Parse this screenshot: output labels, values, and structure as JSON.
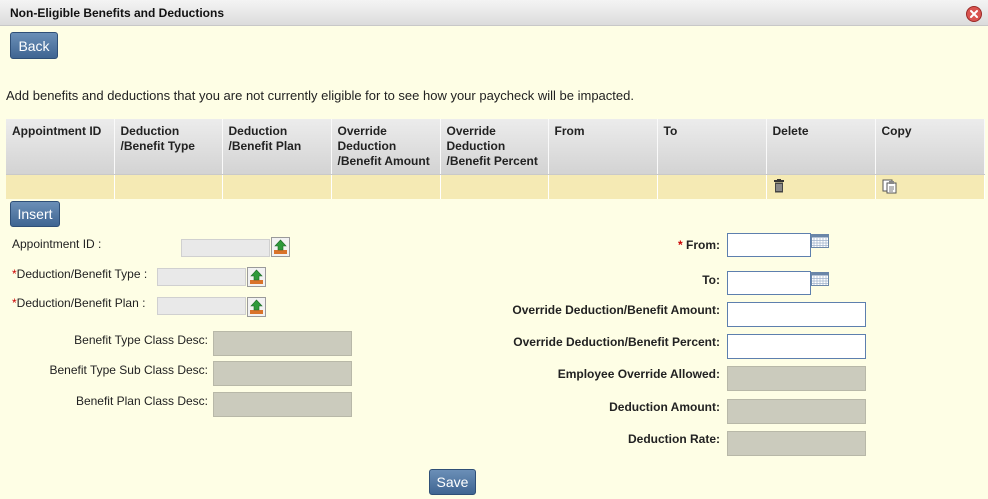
{
  "window": {
    "title": "Non-Eligible Benefits and Deductions"
  },
  "buttons": {
    "back": "Back",
    "insert": "Insert",
    "save": "Save"
  },
  "intro": "Add benefits and deductions that you are not currently eligible for to see how your paycheck will be impacted.",
  "table": {
    "headers": {
      "appointment_id": "Appointment ID",
      "type_line1": "Deduction",
      "type_line2": "/Benefit Type",
      "plan_line1": "Deduction",
      "plan_line2": "/Benefit Plan",
      "amount_line1": "Override",
      "amount_line2": "Deduction",
      "amount_line3": "/Benefit Amount",
      "percent_line1": "Override",
      "percent_line2": "Deduction",
      "percent_line3": "/Benefit Percent",
      "from": "From",
      "to": "To",
      "delete": "Delete",
      "copy": "Copy"
    },
    "rows": [
      {
        "appointment_id": "",
        "type": "",
        "plan": "",
        "amount": "",
        "percent": "",
        "from": "",
        "to": ""
      }
    ]
  },
  "form": {
    "appointment_id_label": "Appointment ID :",
    "required_mark": "*",
    "type_label": "Deduction/Benefit Type :",
    "plan_label": "Deduction/Benefit Plan :",
    "type_class_label": "Benefit Type Class Desc:",
    "type_subclass_label": "Benefit Type Sub Class Desc:",
    "plan_class_label": "Benefit Plan Class Desc:",
    "from_label": "From:",
    "to_label": "To:",
    "override_amount_label": "Override Deduction/Benefit Amount:",
    "override_percent_label": "Override Deduction/Benefit Percent:",
    "employee_override_label": "Employee Override Allowed:",
    "deduction_amount_label": "Deduction Amount:",
    "deduction_rate_label": "Deduction Rate:"
  },
  "icons": {
    "close": "close-icon",
    "delete": "trash-icon",
    "copy": "copy-icon",
    "lookup": "lookup-icon",
    "calendar": "calendar-icon"
  },
  "colors": {
    "page_background": "#fefee5",
    "button_blue": "#4a6f99",
    "row_highlight": "#f5eab4",
    "required": "#cc0000"
  }
}
